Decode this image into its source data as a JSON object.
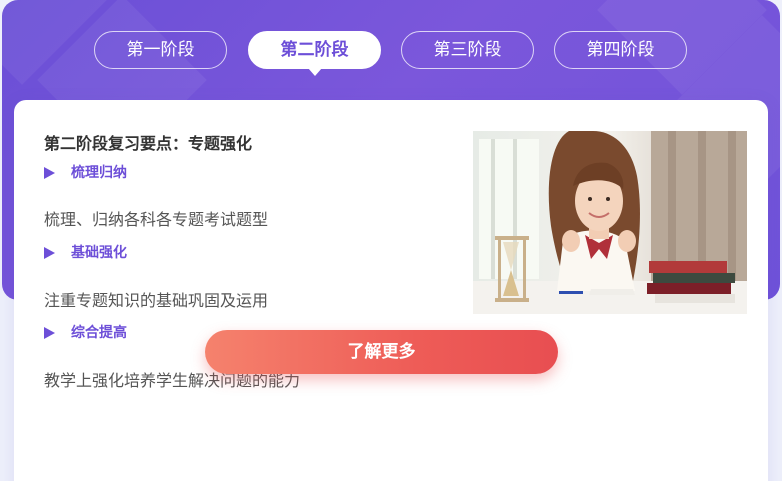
{
  "tabs": [
    {
      "label": "第一阶段",
      "active": false
    },
    {
      "label": "第二阶段",
      "active": true
    },
    {
      "label": "第三阶段",
      "active": false
    },
    {
      "label": "第四阶段",
      "active": false
    }
  ],
  "content": {
    "heading": "第二阶段复习要点：专题强化",
    "points": [
      {
        "title": "梳理归纳",
        "desc": "梳理、归纳各科各专题考试题型"
      },
      {
        "title": "基础强化",
        "desc": "注重专题知识的基础巩固及运用"
      },
      {
        "title": "综合提高",
        "desc": "教学上强化培养学生解决问题的能力"
      }
    ],
    "photo_icon": "student-photo-icon"
  },
  "cta": {
    "label": "了解更多"
  },
  "colors": {
    "brand_purple": "#6d4fd8",
    "cta_start": "#f5826d",
    "cta_end": "#e84e51"
  }
}
